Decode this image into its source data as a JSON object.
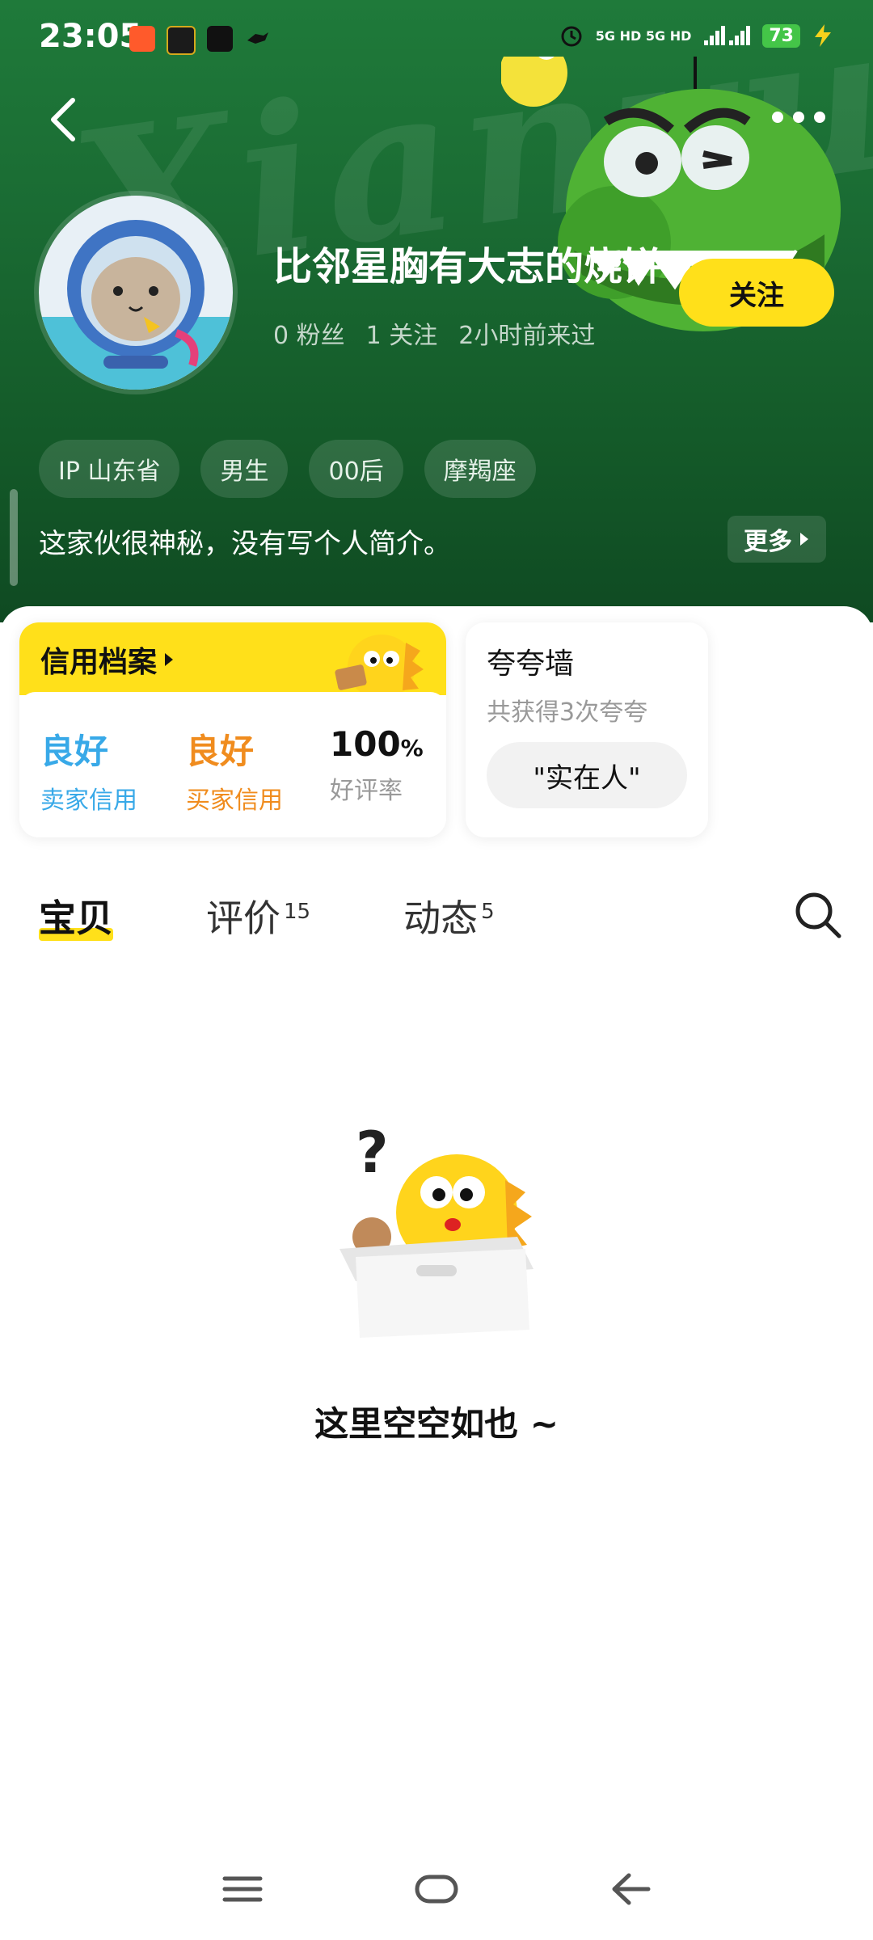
{
  "status_bar": {
    "time": "23:05",
    "network": "5G HD 5G HD",
    "battery": "73"
  },
  "profile": {
    "username": "比邻星胸有大志的烧饼",
    "followers": "0 粉丝",
    "following": "1 关注",
    "last_seen": "2小时前来过",
    "follow_label": "关注",
    "tags": [
      "IP 山东省",
      "男生",
      "00后",
      "摩羯座"
    ],
    "bio": "这家伙很神秘，没有写个人简介。",
    "more_label": "更多"
  },
  "credit": {
    "title": "信用档案",
    "seller_value": "良好",
    "seller_label": "卖家信用",
    "buyer_value": "良好",
    "buyer_label": "买家信用",
    "rating_value": "100",
    "rating_unit": "%",
    "rating_label": "好评率"
  },
  "praise": {
    "title": "夸夸墙",
    "subtitle": "共获得3次夸夸",
    "chip": "\"实在人\""
  },
  "tabs": [
    {
      "label": "宝贝",
      "count": ""
    },
    {
      "label": "评价",
      "count": "15"
    },
    {
      "label": "动态",
      "count": "5"
    }
  ],
  "empty_state": {
    "text": "这里空空如也 ~"
  },
  "colors": {
    "accent_yellow": "#ffe01a",
    "header_green": "#1f7a3a",
    "seller_blue": "#38a9e8",
    "buyer_orange": "#f08c1e"
  },
  "icons": {
    "back": "back-arrow-icon",
    "more": "more-dots-icon",
    "search": "search-icon",
    "nav_menu": "menu-icon",
    "nav_home": "home-icon",
    "nav_back": "back-icon"
  }
}
